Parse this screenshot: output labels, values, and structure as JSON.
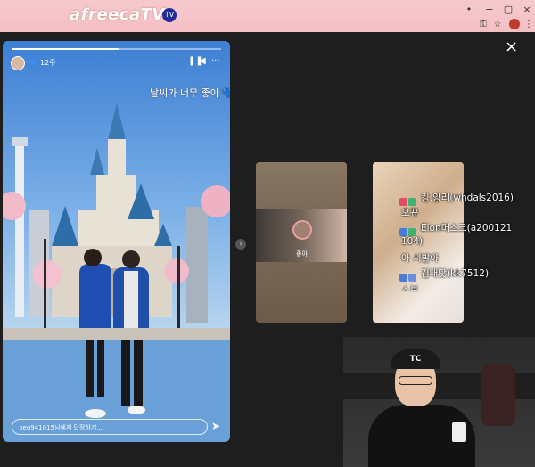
{
  "browser": {
    "logo_text": "afreecaTV",
    "logo_badge": "TV",
    "window_controls": [
      "•",
      "−",
      "▢",
      "×"
    ],
    "toolbar_icons": [
      "key-icon",
      "star-icon",
      "profile-icon",
      "menu-icon"
    ]
  },
  "viewer": {
    "close_label": "×",
    "story": {
      "time_ago": "12주",
      "caption": "날씨가 너무 좋아 💙",
      "reply_placeholder": "seo941015님에게 답장하기...",
      "pause_label": "❚❚",
      "sound_label": "◀",
      "more_label": "···",
      "send_label": "➤",
      "progress": 0.51
    },
    "next_arrow": "›",
    "thumb1": {
      "caption": "좋아"
    }
  },
  "chat": {
    "messages": [
      {
        "nick": "킹.앙리(whdals2016)",
        "text": "오뀨",
        "badge_colors": [
          "#e24b6a",
          "#3cb371"
        ]
      },
      {
        "nick": "Elon머스크(a200121",
        "text": "104)",
        "badge_colors": [
          "#4a7bd8",
          "#3cb371"
        ]
      },
      {
        "nick": "",
        "text": "아 시발아",
        "badge_colors": []
      },
      {
        "nick": "김대닷(kk7512)",
        "text": "ㅅㅂ",
        "badge_colors": [
          "#4a7bd8",
          "#6b8fe0"
        ]
      }
    ]
  },
  "webcam": {
    "cap_text": "TC"
  },
  "colors": {
    "chrome_pink": "#f3c0c4",
    "viewer_bg": "#1e1e1e",
    "accent_blue": "#3a8ef0"
  }
}
